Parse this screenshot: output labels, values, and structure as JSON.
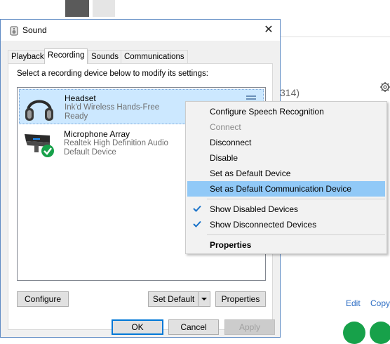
{
  "dialog": {
    "title": "Sound",
    "tabs": [
      "Playback",
      "Recording",
      "Sounds",
      "Communications"
    ],
    "instruction": "Select a recording device below to modify its settings:",
    "devices": [
      {
        "name": "Headset",
        "line1": "Ink'd Wireless Hands-Free",
        "line2": "Ready"
      },
      {
        "name": "Microphone Array",
        "line1": "Realtek High Definition Audio",
        "line2": "Default Device"
      }
    ],
    "buttons": {
      "configure": "Configure",
      "set_default": "Set Default",
      "properties": "Properties",
      "ok": "OK",
      "cancel": "Cancel",
      "apply": "Apply"
    }
  },
  "context_menu": {
    "items": [
      "Configure Speech Recognition",
      "Connect",
      "Disconnect",
      "Disable",
      "Set as Default Device",
      "Set as Default Communication Device",
      "Show Disabled Devices",
      "Show Disconnected Devices",
      "Properties"
    ]
  },
  "background": {
    "partial_text": "314)",
    "edit_link": "Edit",
    "copy_link": "Copy"
  },
  "colors": {
    "accent": "#0078d7",
    "menu_hover": "#91c9f7",
    "selection": "#cce8ff",
    "green": "#17a14a"
  }
}
